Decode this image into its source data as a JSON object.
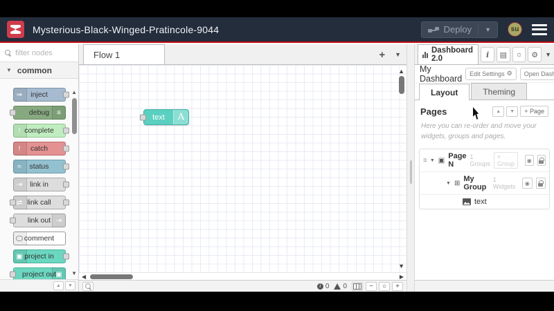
{
  "colors": {
    "header_bg": "#232d3c",
    "brand_red": "#cf3d4c",
    "deploy_line": "#c20a12",
    "widget_teal": "#5bd0c1"
  },
  "header": {
    "title": "Mysterious-Black-Winged-Pratincole-9044",
    "deploy_label": "Deploy",
    "avatar_text": "su"
  },
  "palette": {
    "search_placeholder": "filter nodes",
    "category": "common",
    "nodes": [
      {
        "label": "inject",
        "color": "#a6bbcf",
        "border": "#7e95a9",
        "icon": "⇒",
        "icon_side": "left",
        "in": false,
        "out": true
      },
      {
        "label": "debug",
        "color": "#87a980",
        "border": "#688a60",
        "icon": "≡",
        "icon_side": "right",
        "in": true,
        "out": false
      },
      {
        "label": "complete",
        "color": "#c0edc0",
        "border": "#93c294",
        "icon": "!",
        "icon_side": "left",
        "in": false,
        "out": true
      },
      {
        "label": "catch",
        "color": "#e49191",
        "border": "#bd6a6a",
        "icon": "!",
        "icon_side": "left",
        "in": false,
        "out": true
      },
      {
        "label": "status",
        "color": "#94c1d0",
        "border": "#6d9cae",
        "icon": "≈",
        "icon_side": "left",
        "in": false,
        "out": true
      },
      {
        "label": "link in",
        "color": "#dddddd",
        "border": "#a8a8a8",
        "icon": "⇥",
        "icon_side": "left",
        "in": false,
        "out": true
      },
      {
        "label": "link call",
        "color": "#dddddd",
        "border": "#a8a8a8",
        "icon": "⇄",
        "icon_side": "left",
        "in": true,
        "out": true
      },
      {
        "label": "link out",
        "color": "#dddddd",
        "border": "#a8a8a8",
        "icon": "⇥",
        "icon_side": "right",
        "in": true,
        "out": false
      },
      {
        "label": "comment",
        "color": "#ffffff",
        "border": "#9a9a9a",
        "icon": "bubble",
        "icon_side": "left",
        "in": false,
        "out": false
      },
      {
        "label": "project in",
        "color": "#6bd7c0",
        "border": "#4cb39c",
        "icon": "▣",
        "icon_side": "left",
        "in": false,
        "out": true
      },
      {
        "label": "project out",
        "color": "#6bd7c0",
        "border": "#4cb39c",
        "icon": "▣",
        "icon_side": "right",
        "in": true,
        "out": false
      }
    ]
  },
  "canvas": {
    "tab_label": "Flow 1",
    "add_flow_label": "+",
    "node": {
      "label": "text",
      "icon_letter": "A",
      "color": "#5bd0c1",
      "border": "#43b2a4"
    }
  },
  "footer": {
    "info_count": "0",
    "warning_count": "0",
    "zoom_out": "−",
    "zoom_reset": "○",
    "zoom_in": "+"
  },
  "sidebar": {
    "active_tab": "Dashboard 2.0",
    "dashboard_title": "My Dashboard",
    "edit_settings_label": "Edit Settings",
    "open_dashboard_label": "Open Dashboard",
    "tabs": [
      "Layout",
      "Theming"
    ],
    "pages_title": "Pages",
    "add_page_label": "+ Page",
    "help_text": "Here you can re-order and move your widgets, groups and pages.",
    "tree": {
      "page": {
        "name": "Page N",
        "count": "1 Groups",
        "add_group_label": "+ Group"
      },
      "group": {
        "name": "My Group",
        "count": "1 Widgets"
      },
      "widget": {
        "name": "text"
      }
    }
  }
}
